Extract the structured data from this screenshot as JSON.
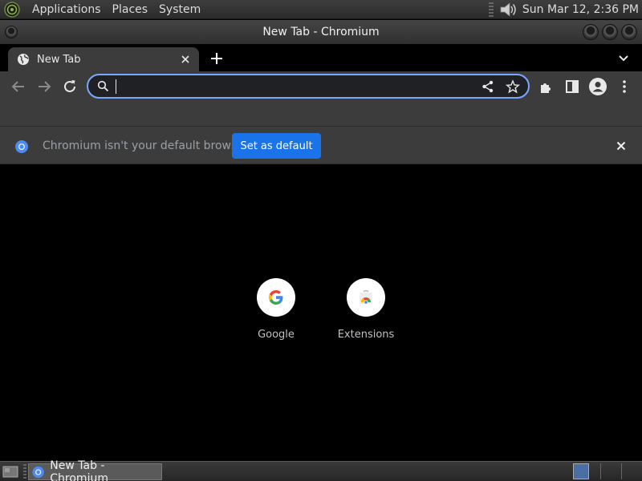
{
  "system_panel": {
    "menus": [
      "Applications",
      "Places",
      "System"
    ],
    "clock": "Sun Mar 12,  2:36 PM"
  },
  "window": {
    "title": "New Tab - Chromium"
  },
  "tabs": [
    {
      "label": "New Tab",
      "active": true
    }
  ],
  "omnibox": {
    "value": "",
    "placeholder": ""
  },
  "infobar": {
    "message": "Chromium isn't your default browser",
    "button_label": "Set as default"
  },
  "shortcuts": [
    {
      "label": "Google",
      "icon": "google-logo-icon"
    },
    {
      "label": "Extensions",
      "icon": "chrome-web-store-icon"
    }
  ],
  "taskbar": {
    "items": [
      {
        "label": "New Tab - Chromium"
      }
    ]
  },
  "colors": {
    "accent": "#1a73e8",
    "omnibox_focus": "#7aa7ff",
    "toolbar_bg": "#3c3c3c",
    "content_bg": "#000000"
  }
}
